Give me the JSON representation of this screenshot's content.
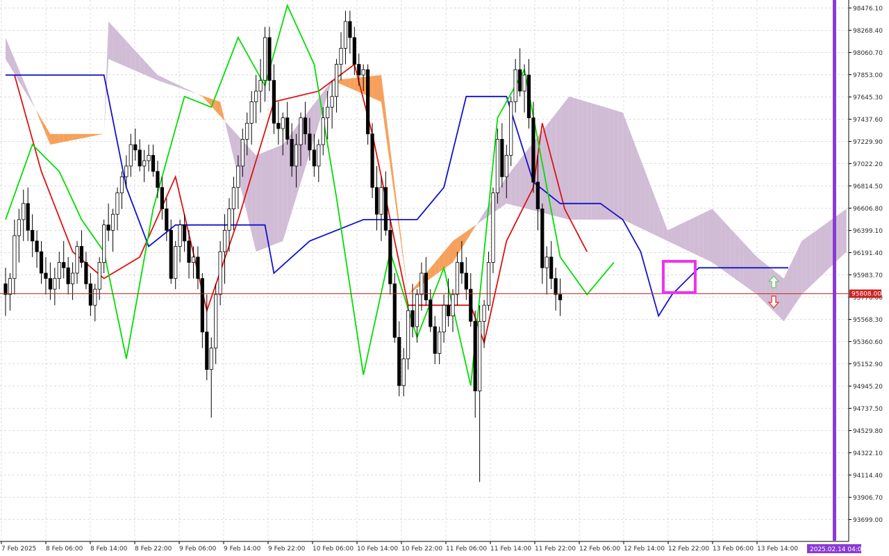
{
  "chart_data": {
    "type": "candlestick",
    "price_axis": {
      "ticks": [
        "98476.10",
        "98268.40",
        "98060.70",
        "97853.00",
        "97645.30",
        "97437.60",
        "97229.90",
        "97022.20",
        "96814.50",
        "96606.80",
        "96399.10",
        "96191.40",
        "95983.70",
        "95776.00",
        "95568.30",
        "95360.60",
        "95152.90",
        "94945.20",
        "94737.50",
        "94529.80",
        "94322.10",
        "94114.40",
        "93906.70",
        "93699.00"
      ],
      "ylim": [
        93600,
        98530
      ]
    },
    "time_axis": {
      "labels": [
        "7 Feb 2025",
        "8 Feb 06:00",
        "8 Feb 14:00",
        "8 Feb 22:00",
        "9 Feb 06:00",
        "9 Feb 14:00",
        "9 Feb 22:00",
        "10 Feb 06:00",
        "10 Feb 14:00",
        "10 Feb 22:00",
        "11 Feb 06:00",
        "11 Feb 14:00",
        "11 Feb 22:00",
        "12 Feb 06:00",
        "12 Feb 14:00",
        "12 Feb 22:00",
        "13 Feb 06:00",
        "13 Feb 14:00"
      ],
      "cursor_label": "2025.02.14 04:00",
      "bars_visible": 172,
      "bars_projected": 16
    },
    "current_price": {
      "label": "95808.00",
      "value": 95808.0,
      "color": "#cc2020"
    },
    "candles": [
      [
        95900,
        96050,
        95600,
        95800
      ],
      [
        95800,
        96000,
        95650,
        95950
      ],
      [
        95950,
        96500,
        95800,
        96350
      ],
      [
        96350,
        96600,
        96100,
        96500
      ],
      [
        96500,
        96780,
        96300,
        96650
      ],
      [
        96650,
        96800,
        96300,
        96400
      ],
      [
        96400,
        96550,
        96150,
        96300
      ],
      [
        96300,
        96400,
        96050,
        96200
      ],
      [
        96200,
        96300,
        95900,
        96000
      ],
      [
        96000,
        96150,
        95800,
        95950
      ],
      [
        95950,
        96100,
        95750,
        95850
      ],
      [
        95850,
        96050,
        95700,
        95950
      ],
      [
        95950,
        96200,
        95850,
        96100
      ],
      [
        96100,
        96300,
        95950,
        96050
      ],
      [
        96050,
        96150,
        95800,
        95900
      ],
      [
        95900,
        96100,
        95750,
        96000
      ],
      [
        96000,
        96300,
        95900,
        96250
      ],
      [
        96250,
        96400,
        96050,
        96100
      ],
      [
        96100,
        96200,
        95850,
        95900
      ],
      [
        95900,
        96000,
        95600,
        95700
      ],
      [
        95700,
        95900,
        95550,
        95850
      ],
      [
        95850,
        96150,
        95750,
        96100
      ],
      [
        96100,
        96500,
        96000,
        96450
      ],
      [
        96450,
        96650,
        96300,
        96400
      ],
      [
        96400,
        96600,
        96200,
        96550
      ],
      [
        96550,
        96800,
        96400,
        96750
      ],
      [
        96750,
        96950,
        96600,
        96900
      ],
      [
        96900,
        97100,
        96800,
        97000
      ],
      [
        97000,
        97300,
        96900,
        97200
      ],
      [
        97200,
        97350,
        97050,
        97150
      ],
      [
        97150,
        97250,
        96950,
        97000
      ],
      [
        97000,
        97150,
        96850,
        97050
      ],
      [
        97050,
        97200,
        96950,
        97100
      ],
      [
        97100,
        97200,
        96900,
        96950
      ],
      [
        96950,
        97050,
        96700,
        96800
      ],
      [
        96800,
        96900,
        96500,
        96600
      ],
      [
        96600,
        96700,
        96300,
        96400
      ],
      [
        96400,
        96500,
        95900,
        95950
      ],
      [
        95950,
        96300,
        95850,
        96250
      ],
      [
        96250,
        96500,
        96100,
        96450
      ],
      [
        96450,
        96550,
        96200,
        96300
      ],
      [
        96300,
        96400,
        95950,
        96100
      ],
      [
        96100,
        96250,
        95950,
        96150
      ],
      [
        96150,
        96250,
        95850,
        95950
      ],
      [
        95950,
        96000,
        95300,
        95450
      ],
      [
        95450,
        95800,
        95000,
        95100
      ],
      [
        95100,
        95400,
        94650,
        95300
      ],
      [
        95300,
        95900,
        95150,
        95800
      ],
      [
        95800,
        96300,
        95700,
        96200
      ],
      [
        96200,
        96550,
        95900,
        96400
      ],
      [
        96400,
        96700,
        96200,
        96600
      ],
      [
        96600,
        96900,
        96400,
        96800
      ],
      [
        96800,
        97100,
        96600,
        97000
      ],
      [
        97000,
        97350,
        96900,
        97250
      ],
      [
        97250,
        97500,
        97100,
        97400
      ],
      [
        97400,
        97700,
        97200,
        97600
      ],
      [
        97600,
        97850,
        97400,
        97700
      ],
      [
        97700,
        98000,
        97500,
        97800
      ],
      [
        97800,
        98300,
        97600,
        98200
      ],
      [
        98200,
        98300,
        97700,
        97800
      ],
      [
        97800,
        97950,
        97300,
        97400
      ],
      [
        97400,
        97600,
        97200,
        97350
      ],
      [
        97350,
        97500,
        97100,
        97450
      ],
      [
        97450,
        97600,
        97200,
        97250
      ],
      [
        97250,
        97400,
        96900,
        97000
      ],
      [
        97000,
        97300,
        96800,
        97200
      ],
      [
        97200,
        97500,
        97000,
        97450
      ],
      [
        97450,
        97600,
        97200,
        97300
      ],
      [
        97300,
        97450,
        97050,
        97150
      ],
      [
        97150,
        97300,
        96900,
        97000
      ],
      [
        97000,
        97250,
        96850,
        97200
      ],
      [
        97200,
        97550,
        97100,
        97450
      ],
      [
        97450,
        97700,
        97250,
        97550
      ],
      [
        97550,
        97800,
        97350,
        97650
      ],
      [
        97650,
        98000,
        97500,
        97950
      ],
      [
        97950,
        98250,
        97800,
        98100
      ],
      [
        98100,
        98450,
        97950,
        98350
      ],
      [
        98350,
        98450,
        98050,
        98200
      ],
      [
        98200,
        98300,
        97850,
        97950
      ],
      [
        97950,
        98050,
        97750,
        97850
      ],
      [
        97850,
        97950,
        97700,
        97900
      ],
      [
        97900,
        97950,
        97200,
        97300
      ],
      [
        97300,
        97400,
        96700,
        96800
      ],
      [
        96800,
        97000,
        96400,
        96550
      ],
      [
        96550,
        96900,
        96300,
        96800
      ],
      [
        96800,
        96950,
        96350,
        96400
      ],
      [
        96400,
        96500,
        95800,
        95900
      ],
      [
        95900,
        96000,
        95350,
        95400
      ],
      [
        95400,
        95550,
        94850,
        94950
      ],
      [
        94950,
        95300,
        94850,
        95200
      ],
      [
        95200,
        95700,
        95100,
        95650
      ],
      [
        95650,
        95900,
        95400,
        95500
      ],
      [
        95500,
        95850,
        95350,
        95800
      ],
      [
        95800,
        96100,
        95650,
        96000
      ],
      [
        96000,
        96150,
        95700,
        95750
      ],
      [
        95750,
        95850,
        95450,
        95500
      ],
      [
        95500,
        95600,
        95150,
        95250
      ],
      [
        95250,
        95500,
        95150,
        95450
      ],
      [
        95450,
        95800,
        95350,
        95700
      ],
      [
        95700,
        95950,
        95500,
        95600
      ],
      [
        95600,
        95850,
        95450,
        95800
      ],
      [
        95800,
        96200,
        95700,
        96100
      ],
      [
        96100,
        96300,
        95900,
        96000
      ],
      [
        96000,
        96150,
        95750,
        95850
      ],
      [
        95850,
        96000,
        95500,
        95550
      ],
      [
        95550,
        95650,
        94650,
        94900
      ],
      [
        94900,
        95700,
        94050,
        95550
      ],
      [
        95550,
        95750,
        95300,
        95700
      ],
      [
        95700,
        96200,
        95650,
        96100
      ],
      [
        96100,
        96800,
        96000,
        96750
      ],
      [
        96750,
        97350,
        96650,
        97250
      ],
      [
        97250,
        97400,
        96800,
        96900
      ],
      [
        96900,
        97200,
        96700,
        97100
      ],
      [
        97100,
        97650,
        97000,
        97600
      ],
      [
        97600,
        98000,
        97500,
        97900
      ],
      [
        97900,
        98100,
        97650,
        97700
      ],
      [
        97700,
        97950,
        97500,
        97850
      ],
      [
        97850,
        98000,
        97350,
        97450
      ],
      [
        97450,
        97600,
        96750,
        96850
      ],
      [
        96850,
        97100,
        96400,
        96600
      ],
      [
        96600,
        96650,
        95900,
        96050
      ],
      [
        96050,
        96250,
        95800,
        96150
      ],
      [
        96150,
        96300,
        95850,
        95950
      ],
      [
        95950,
        96050,
        95650,
        95800
      ],
      [
        95800,
        95950,
        95600,
        95750
      ]
    ],
    "lines": [
      {
        "id": "tenkan",
        "color": "#dd1111",
        "points": [
          [
            2,
            97850
          ],
          [
            8,
            96950
          ],
          [
            15,
            96200
          ],
          [
            22,
            95950
          ],
          [
            30,
            96150
          ],
          [
            38,
            96900
          ],
          [
            45,
            95650
          ],
          [
            52,
            96500
          ],
          [
            60,
            97600
          ],
          [
            70,
            97700
          ],
          [
            78,
            97950
          ],
          [
            82,
            97300
          ],
          [
            90,
            95700
          ],
          [
            97,
            95700
          ],
          [
            104,
            95700
          ],
          [
            107,
            95350
          ],
          [
            112,
            96300
          ],
          [
            118,
            96800
          ],
          [
            120,
            97400
          ],
          [
            125,
            96600
          ],
          [
            130,
            96200
          ]
        ]
      },
      {
        "id": "kijun",
        "color": "#1111cc",
        "points": [
          [
            0,
            97850
          ],
          [
            22,
            97850
          ],
          [
            27,
            96800
          ],
          [
            32,
            96250
          ],
          [
            38,
            96450
          ],
          [
            58,
            96450
          ],
          [
            60,
            96000
          ],
          [
            68,
            96300
          ],
          [
            80,
            96500
          ],
          [
            92,
            96500
          ],
          [
            98,
            96800
          ],
          [
            103,
            97650
          ],
          [
            112,
            97650
          ],
          [
            118,
            96850
          ],
          [
            124,
            96650
          ],
          [
            133,
            96650
          ],
          [
            138,
            96500
          ],
          [
            142,
            96200
          ],
          [
            146,
            95600
          ],
          [
            149,
            95800
          ],
          [
            155,
            96050
          ],
          [
            175,
            96050
          ]
        ]
      },
      {
        "id": "chikou",
        "color": "#00dd00",
        "points": [
          [
            0,
            96500
          ],
          [
            6,
            97200
          ],
          [
            12,
            96950
          ],
          [
            17,
            96500
          ],
          [
            22,
            96200
          ],
          [
            27,
            95200
          ],
          [
            33,
            96600
          ],
          [
            40,
            97650
          ],
          [
            46,
            97550
          ],
          [
            52,
            98200
          ],
          [
            58,
            97750
          ],
          [
            63,
            98500
          ],
          [
            69,
            97950
          ],
          [
            74,
            96700
          ],
          [
            80,
            95050
          ],
          [
            86,
            96200
          ],
          [
            92,
            95400
          ],
          [
            98,
            96050
          ],
          [
            104,
            94950
          ],
          [
            110,
            97450
          ],
          [
            116,
            97900
          ],
          [
            124,
            96150
          ],
          [
            130,
            95800
          ],
          [
            136,
            96100
          ]
        ]
      }
    ],
    "cloud": {
      "span_a": [
        [
          0,
          98200
        ],
        [
          10,
          97200
        ],
        [
          22,
          97300
        ],
        [
          23,
          98350
        ],
        [
          34,
          97850
        ],
        [
          44,
          97650
        ],
        [
          56,
          97100
        ],
        [
          62,
          97200
        ],
        [
          73,
          97800
        ],
        [
          84,
          97600
        ],
        [
          90,
          95800
        ],
        [
          100,
          96100
        ],
        [
          112,
          96900
        ],
        [
          126,
          97650
        ],
        [
          138,
          97500
        ],
        [
          148,
          96400
        ],
        [
          158,
          96600
        ],
        [
          168,
          96150
        ],
        [
          174,
          95950
        ],
        [
          178,
          96300
        ],
        [
          188,
          96600
        ]
      ],
      "span_b": [
        [
          0,
          98000
        ],
        [
          10,
          97300
        ],
        [
          22,
          97300
        ],
        [
          23,
          98000
        ],
        [
          34,
          97800
        ],
        [
          48,
          97600
        ],
        [
          56,
          96200
        ],
        [
          62,
          96300
        ],
        [
          73,
          97800
        ],
        [
          84,
          97850
        ],
        [
          90,
          95800
        ],
        [
          100,
          96300
        ],
        [
          112,
          96650
        ],
        [
          126,
          96500
        ],
        [
          138,
          96500
        ],
        [
          148,
          96300
        ],
        [
          158,
          96100
        ],
        [
          168,
          95800
        ],
        [
          174,
          95550
        ],
        [
          178,
          95800
        ],
        [
          188,
          96200
        ]
      ],
      "bull_color": "#d1bcd6",
      "bear_color": "#f5a15c"
    },
    "markers": {
      "up_arrow_color": "#7ec97e",
      "down_arrow_color": "#e24a4a",
      "box_color": "#ee33ee",
      "cursor_line_color": "#8b3ad6"
    }
  }
}
